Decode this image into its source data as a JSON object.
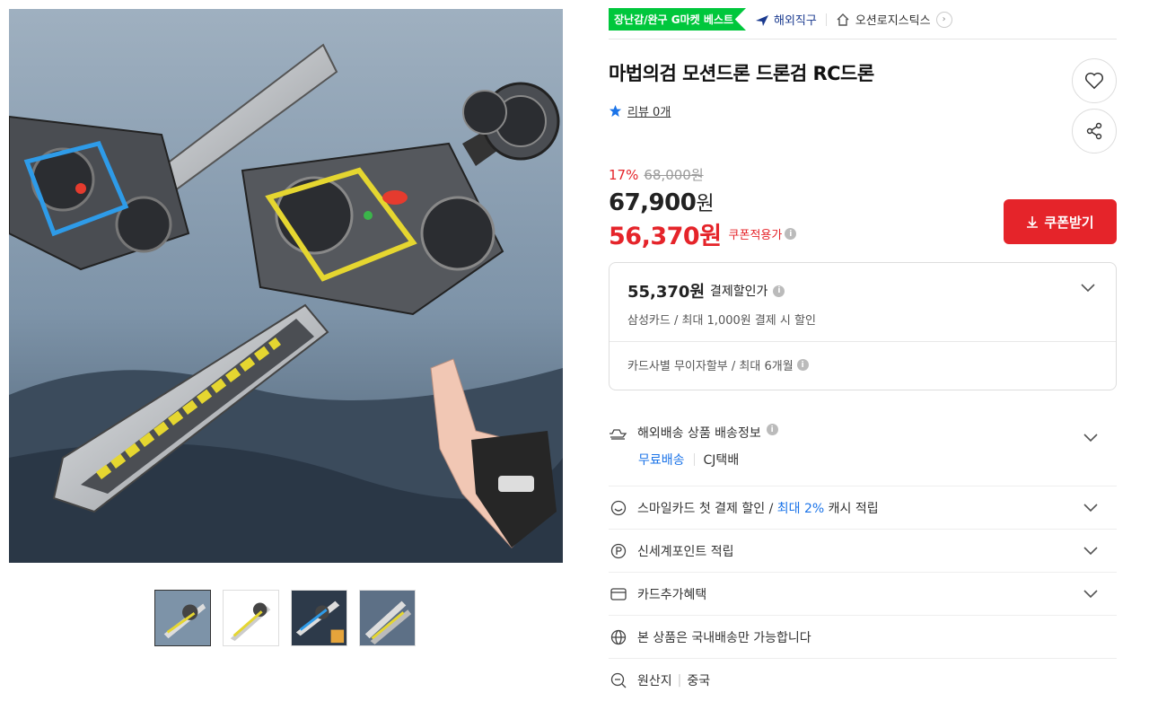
{
  "header": {
    "best_badge": "장난감/완구 G마켓 베스트",
    "overseas_label": "해외직구",
    "shop_name": "오션로지스틱스"
  },
  "product": {
    "title": "마법의검 모션드론 드론검 RC드론",
    "review_text": "리뷰 0개"
  },
  "price": {
    "discount_rate": "17%",
    "original": "68,000원",
    "sale": "67,900",
    "sale_unit": "원",
    "coupon_price": "56,370원",
    "coupon_label": "쿠폰적용가",
    "coupon_button": "쿠폰받기"
  },
  "payment": {
    "price": "55,370원",
    "label": "결제할인가",
    "sub": "삼성카드 / 최대 1,000원 결제 시 할인",
    "installment": "카드사별 무이자할부 / 최대 6개월"
  },
  "info": {
    "shipping_title": "해외배송 상품 배송정보",
    "shipping_free": "무료배송",
    "shipping_carrier": "CJ택배",
    "smile_prefix": "스마일카드 첫 결제 할인 /",
    "smile_highlight": "최대 2%",
    "smile_suffix": "캐시 적립",
    "shinsegae": "신세계포인트 적립",
    "card_benefit": "카드추가혜택",
    "domestic": "본 상품은 국내배송만 가능합니다",
    "origin_label": "원산지",
    "origin_value": "중국"
  },
  "colors": {
    "accent_red": "#e5242a",
    "link_blue": "#1a73e8",
    "best_green": "#00c73c"
  },
  "icons": [
    "plane-icon",
    "home-icon",
    "heart-icon",
    "share-icon",
    "star-icon",
    "download-icon",
    "chevron-down-icon",
    "truck-icon",
    "smile-icon",
    "point-icon",
    "card-icon",
    "globe-icon",
    "search-icon"
  ]
}
